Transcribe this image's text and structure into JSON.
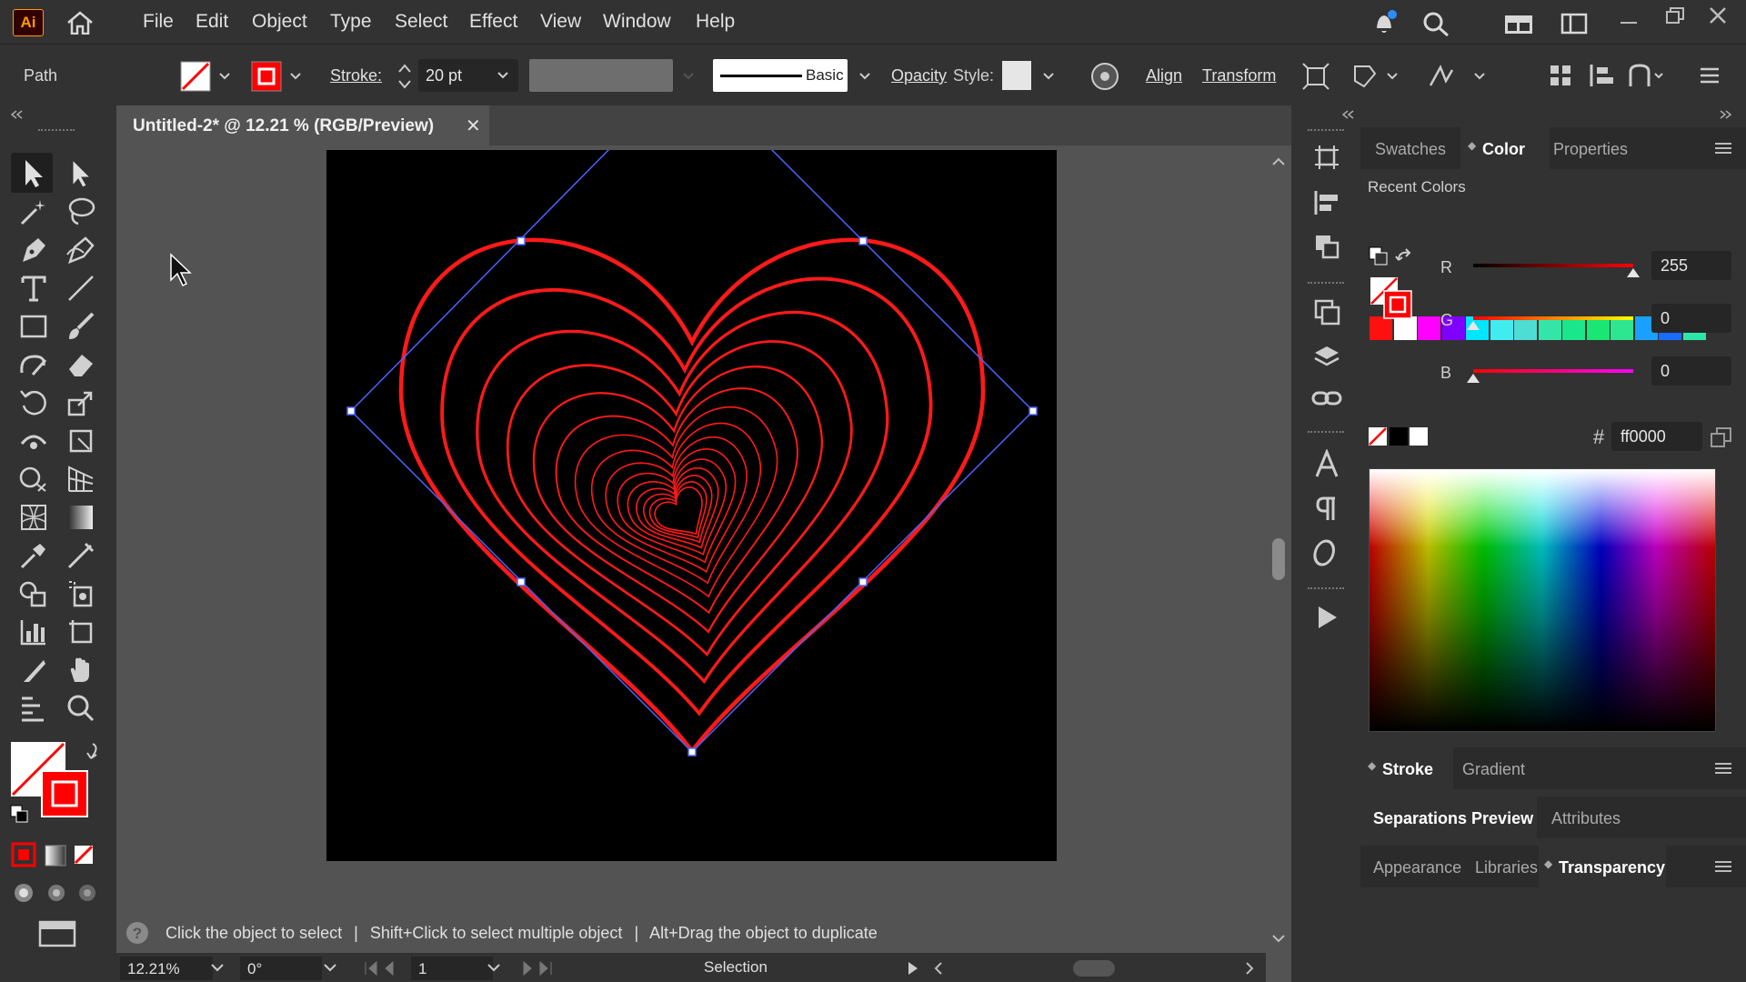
{
  "app": {
    "logo": "Ai"
  },
  "menu": [
    "File",
    "Edit",
    "Object",
    "Type",
    "Select",
    "Effect",
    "View",
    "Window",
    "Help"
  ],
  "control_bar": {
    "selection_type": "Path",
    "stroke_label": "Stroke:",
    "stroke_value": "20 pt",
    "brush_label": "Basic",
    "opacity_label": "Opacity",
    "style_label": "Style:",
    "align_label": "Align",
    "transform_label": "Transform"
  },
  "document_tab": {
    "title": "Untitled-2* @ 12.21 % (RGB/Preview)",
    "close": "✕"
  },
  "status": {
    "hint_1": "Click the object to select",
    "hint_2": "Shift+Click to select multiple object",
    "hint_3": "Alt+Drag the object to duplicate",
    "separator": "|"
  },
  "bottom_bar": {
    "zoom": "12.21%",
    "rotation": "0°",
    "artboard": "1",
    "tool": "Selection"
  },
  "panels": {
    "tabs_top": [
      "Swatches",
      "Color",
      "Properties"
    ],
    "active_top": "Color",
    "recent_colors_label": "Recent Colors",
    "recent_colors": [
      "#ff1010",
      "#ffffff",
      "#ff00ff",
      "#8000ff",
      "#00e6ff",
      "#40ecf0",
      "#4dddd5",
      "#33e6a8",
      "#1ae68c",
      "#1ae673",
      "#2ee690",
      "#1aa0ff",
      "#1a6cff",
      "#2ee6a8"
    ],
    "rgb": {
      "r_label": "R",
      "g_label": "G",
      "b_label": "B",
      "r": "255",
      "g": "0",
      "b": "0"
    },
    "hex_symbol": "#",
    "hex": "ff0000",
    "tabs_stroke": [
      "Stroke",
      "Gradient"
    ],
    "tabs_sep": [
      "Separations Preview",
      "Attributes"
    ],
    "tabs_app": [
      "Appearance",
      "Libraries",
      "Transparency"
    ],
    "active_app": "Transparency"
  },
  "colors": {
    "stroke": "#ff0000",
    "selection": "#4a64ff",
    "heart": "#ff1a1a"
  }
}
